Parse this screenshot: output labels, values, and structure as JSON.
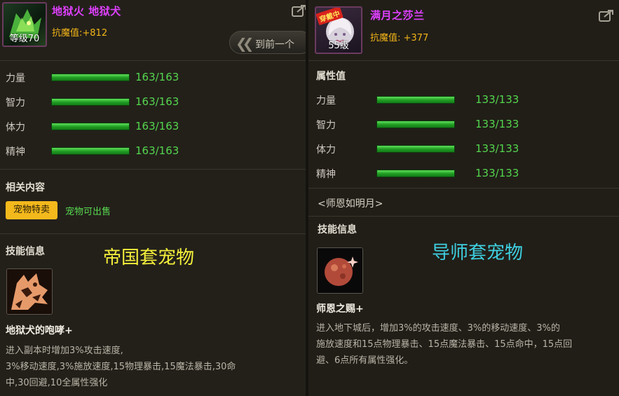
{
  "left": {
    "pet_name": "地狱火 地狱犬",
    "level_label": "等级70",
    "resist_label": "抗魔值:+812",
    "prev_button": "到前一个",
    "stats": [
      {
        "label": "力量",
        "value": "163/163"
      },
      {
        "label": "智力",
        "value": "163/163"
      },
      {
        "label": "体力",
        "value": "163/163"
      },
      {
        "label": "精神",
        "value": "163/163"
      }
    ],
    "related_title": "相关内容",
    "tag_label": "宠物特卖",
    "tag_info": "宠物可出售",
    "skills_title": "技能信息",
    "overlay_text": "帝国套宠物",
    "skill_name": "地狱犬的咆哮+",
    "skill_desc": [
      "进入副本时增加3%攻击速度,",
      "3%移动速度,3%施放速度,15物理暴击,15魔法暴击,30命",
      "中,30回避,10全属性强化"
    ]
  },
  "right": {
    "pet_name": "满月之莎兰",
    "badge": "穿戴中",
    "level_label": "55级",
    "resist_label": "抗魔值: +377",
    "attr_title": "属性值",
    "stats": [
      {
        "label": "力量",
        "value": "133/133"
      },
      {
        "label": "智力",
        "value": "133/133"
      },
      {
        "label": "体力",
        "value": "133/133"
      },
      {
        "label": "精神",
        "value": "133/133"
      }
    ],
    "title_line": "<师恩如明月>",
    "skills_title": "技能信息",
    "overlay_text": "导师套宠物",
    "skill_name": "师恩之赐+",
    "skill_desc": [
      "进入地下城后，增加3%的攻击速度、3%的移动速度、3%的",
      "施放速度和15点物理暴击、15点魔法暴击、15点命中，15点回",
      "避、6点所有属性强化。"
    ]
  },
  "colors": {
    "name": "#e040ff",
    "resist": "#f2b418",
    "stat_value": "#54d64e",
    "overlay_left": "#f5f03a",
    "overlay_right": "#3ed0e0",
    "tag_bg": "#f3b81c"
  },
  "icons": {
    "export": "export-icon",
    "prev": "double-chevron-left-icon",
    "skill_left": "hound-roar-skill-icon",
    "skill_right": "full-moon-skill-icon"
  }
}
